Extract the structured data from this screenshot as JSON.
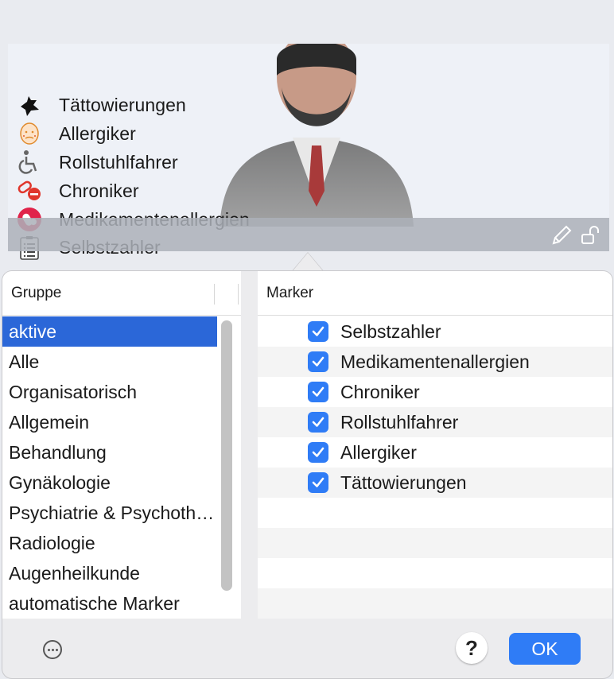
{
  "card": {
    "markers": [
      {
        "label": "Tättowierungen",
        "icon": "tattoo-icon"
      },
      {
        "label": "Allergiker",
        "icon": "allergy-face-icon"
      },
      {
        "label": "Rollstuhlfahrer",
        "icon": "wheelchair-icon"
      },
      {
        "label": "Chroniker",
        "icon": "pill-icon"
      },
      {
        "label": "Medikamentenallergien",
        "icon": "medication-allergy-icon"
      },
      {
        "label": "Selbstzahler",
        "icon": "checklist-icon"
      }
    ],
    "avatar_icon": "patient-avatar-icon",
    "edit_icon": "pencil-icon",
    "lock_icon": "unlock-icon"
  },
  "left": {
    "header": "Gruppe",
    "items": [
      "aktive",
      "Alle",
      "Organisatorisch",
      "Allgemein",
      "Behandlung",
      "Gynäkologie",
      "Psychiatrie & Psychotherapie",
      "Radiologie",
      "Augenheilkunde",
      "automatische Marker"
    ],
    "selected_index": 0
  },
  "right": {
    "header": "Marker",
    "rows": [
      {
        "label": "Selbstzahler",
        "checked": true
      },
      {
        "label": "Medikamentenallergien",
        "checked": true
      },
      {
        "label": "Chroniker",
        "checked": true
      },
      {
        "label": "Rollstuhlfahrer",
        "checked": true
      },
      {
        "label": "Allergiker",
        "checked": true
      },
      {
        "label": "Tättowierungen",
        "checked": true
      }
    ]
  },
  "footer": {
    "help_label": "?",
    "ok_label": "OK"
  },
  "colors": {
    "accent": "#2f7cf6",
    "selection": "#2b67d8"
  }
}
